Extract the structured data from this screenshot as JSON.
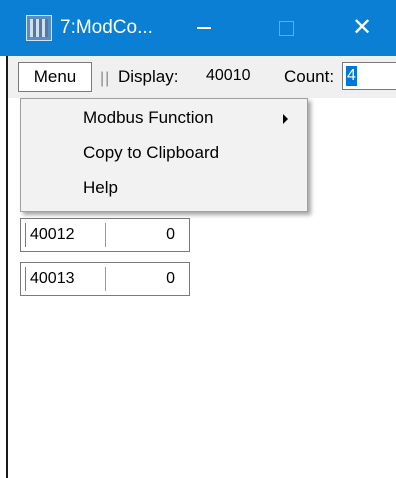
{
  "window": {
    "title": "7:ModCo...",
    "controls": {
      "minimize": "—",
      "maximize": "□",
      "close": "✕"
    }
  },
  "toolbar": {
    "menu_label": "Menu",
    "separator": "||",
    "display_label": "Display:",
    "display_value": "40010",
    "count_label": "Count:",
    "count_value": "4"
  },
  "context_menu": {
    "items": [
      {
        "label": "Modbus Function",
        "has_submenu": true
      },
      {
        "label": "Copy to Clipboard",
        "has_submenu": false
      },
      {
        "label": "Help",
        "has_submenu": false
      }
    ]
  },
  "registers": [
    {
      "address": "40012",
      "value": "0"
    },
    {
      "address": "40013",
      "value": "0"
    }
  ],
  "colors": {
    "titlebar": "#0a7fd4",
    "selection": "#0078d7"
  },
  "icons": [
    "app-icon",
    "submenu-arrow-icon"
  ]
}
